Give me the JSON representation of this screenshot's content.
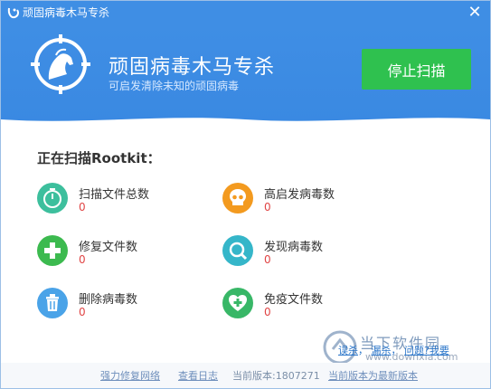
{
  "window": {
    "title": "顽固病毒木马专杀"
  },
  "header": {
    "title": "顽固病毒木马专杀",
    "subtitle": "可启发清除未知的顽固病毒",
    "stop_button": "停止扫描"
  },
  "scan": {
    "heading": "正在扫描Rootkit：",
    "stats": [
      {
        "label": "扫描文件总数",
        "value": "0",
        "icon": "timer-icon",
        "color": "#3dbf9d"
      },
      {
        "label": "高启发病毒数",
        "value": "0",
        "icon": "skull-icon",
        "color": "#f39a1f"
      },
      {
        "label": "修复文件数",
        "value": "0",
        "icon": "plus-icon",
        "color": "#3cba4f"
      },
      {
        "label": "发现病毒数",
        "value": "0",
        "icon": "search-icon",
        "color": "#35b6c9"
      },
      {
        "label": "删除病毒数",
        "value": "0",
        "icon": "trash-icon",
        "color": "#4aa3e8"
      },
      {
        "label": "免疫文件数",
        "value": "0",
        "icon": "heart-icon",
        "color": "#38b767"
      }
    ]
  },
  "feedback": {
    "link1": "误杀",
    "link2": "漏杀",
    "link3": "问题?我要"
  },
  "watermark": {
    "main": "当下软件园",
    "url": "www.downxia.com"
  },
  "footer": {
    "repair_network": "强力修复网络",
    "view_log": "查看日志",
    "current_version": "当前版本:1807271",
    "update_status": "当前版本为最新版本"
  },
  "colors": {
    "primary": "#3f8ee4",
    "stop_button": "#2fc14f",
    "value_red": "#e04545"
  }
}
